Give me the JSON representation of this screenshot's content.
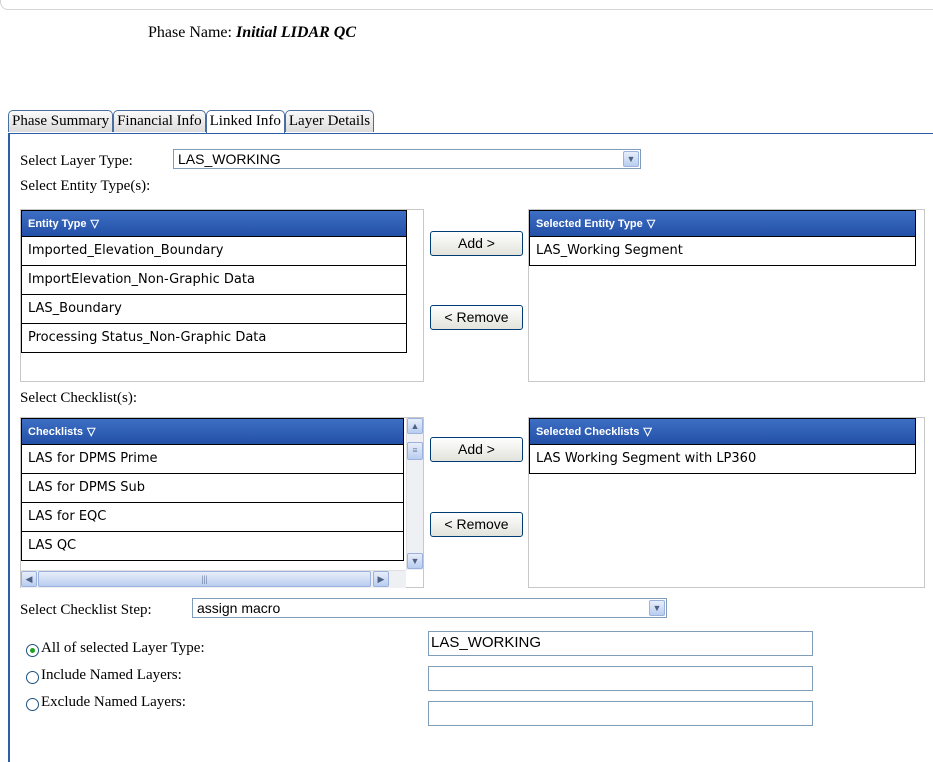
{
  "phase": {
    "label": "Phase Name:",
    "value": "Initial LIDAR QC"
  },
  "tabs": [
    {
      "label": "Phase Summary"
    },
    {
      "label": "Financial Info"
    },
    {
      "label": "Linked Info"
    },
    {
      "label": "Layer Details"
    }
  ],
  "active_tab": "Linked Info",
  "layer_type": {
    "label": "Select Layer Type:",
    "value": "LAS_WORKING"
  },
  "entity_section_label": "Select Entity Type(s):",
  "entity_grid": {
    "header": "Entity Type",
    "items": [
      "Imported_Elevation_Boundary",
      "ImportElevation_Non-Graphic Data",
      "LAS_Boundary",
      "Processing Status_Non-Graphic Data"
    ]
  },
  "entity_add_label": "Add >",
  "entity_remove_label": "< Remove",
  "selected_entity_grid": {
    "header": "Selected Entity Type",
    "items": [
      "LAS_Working Segment"
    ]
  },
  "checklist_section_label": "Select Checklist(s):",
  "checklist_grid": {
    "header": "Checklists",
    "items": [
      "LAS for DPMS Prime",
      "LAS for DPMS Sub",
      "LAS for EQC",
      "LAS QC"
    ]
  },
  "checklist_add_label": "Add >",
  "checklist_remove_label": "< Remove",
  "selected_checklist_grid": {
    "header": "Selected Checklists",
    "items": [
      "LAS Working Segment with LP360"
    ]
  },
  "checklist_step": {
    "label": "Select Checklist Step:",
    "value": "assign macro"
  },
  "layer_options": {
    "all": {
      "label": "All of selected Layer Type:",
      "value": "LAS_WORKING",
      "checked": true
    },
    "include": {
      "label": "Include Named Layers:",
      "value": ""
    },
    "exclude": {
      "label": "Exclude Named Layers:",
      "value": ""
    }
  },
  "icons": {
    "filter": "filter-icon",
    "dropdown": "chevron-down-icon"
  },
  "colors": {
    "grid_header": "#2a58b0",
    "tab_border": "#4a6ea0",
    "radio_on": "#21a121"
  }
}
